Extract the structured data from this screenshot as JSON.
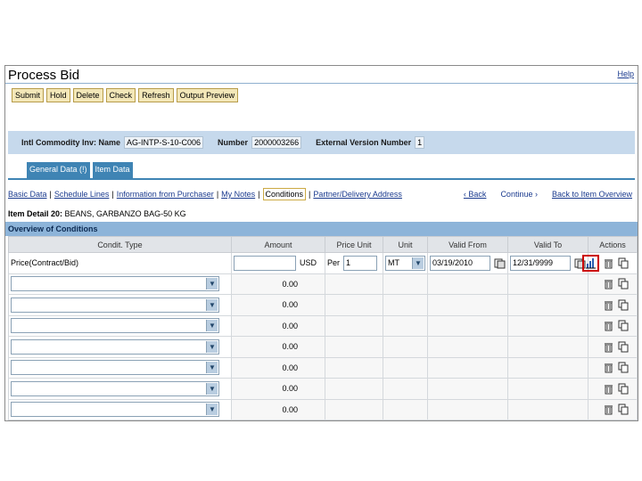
{
  "page": {
    "title": "Process Bid",
    "help": "Help"
  },
  "toolbar": {
    "submit": "Submit",
    "hold": "Hold",
    "delete": "Delete",
    "check": "Check",
    "refresh": "Refresh",
    "output_preview": "Output Preview"
  },
  "header": {
    "name_label": "Intl Commodity Inv: Name",
    "name_value": "AG-INTP-S-10-C006",
    "number_label": "Number",
    "number_value": "2000003266",
    "ext_label": "External Version Number",
    "ext_value": "1"
  },
  "tabs": {
    "general": "General Data (!)",
    "item": "Item Data"
  },
  "subnav": {
    "basic": "Basic Data",
    "schedule": "Schedule Lines",
    "info": "Information from Purchaser",
    "notes": "My Notes",
    "conditions": "Conditions",
    "partner": "Partner/Delivery Address",
    "back": "‹ Back",
    "continue": "Continue ›",
    "back_overview": "Back to Item Overview"
  },
  "item_detail": {
    "label": "Item Detail 20:",
    "value": "BEANS, GARBANZO BAG-50 KG"
  },
  "section": {
    "title": "Overview of Conditions"
  },
  "table": {
    "headers": [
      "Condit. Type",
      "Amount",
      "Price Unit",
      "Unit",
      "Valid From",
      "Valid To",
      "Actions"
    ],
    "first_row": {
      "cond_type": "Price(Contract/Bid)",
      "amount": "",
      "currency": "USD",
      "per_label": "Per",
      "price_unit": "1",
      "unit": "MT",
      "valid_from": "03/19/2010",
      "valid_to": "12/31/9999"
    },
    "empty_amount": "0.00"
  },
  "icons": {
    "dropdown": "chevron-down-icon",
    "calendar": "calendar-icon",
    "scale": "bar-chart-icon",
    "delete": "trash-icon",
    "copy": "copy-icon"
  },
  "colors": {
    "tab": "#3f84b4",
    "section_bar": "#8db4d9",
    "header_band": "#c6d9ec",
    "button": "#f3e7b8",
    "highlight": "#cc0000"
  }
}
